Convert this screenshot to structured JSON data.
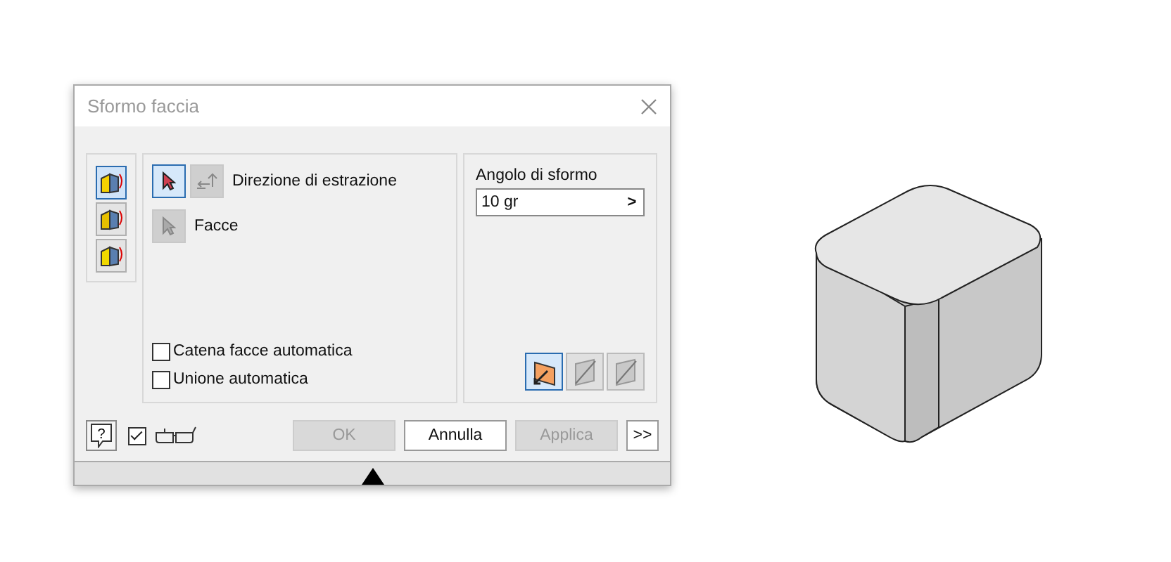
{
  "window": {
    "title": "Sformo faccia"
  },
  "draft_types": [
    {
      "selected": true
    },
    {
      "selected": false
    },
    {
      "selected": false
    }
  ],
  "selectors": [
    {
      "label": "Direzione di estrazione",
      "selected": true,
      "disabled": false,
      "flip": true
    },
    {
      "label": "Facce",
      "selected": false,
      "disabled": true,
      "flip": false
    }
  ],
  "options": [
    {
      "label": "Catena facce automatica",
      "checked": false
    },
    {
      "label": "Unione automatica",
      "checked": false
    }
  ],
  "angle": {
    "label": "Angolo di sformo",
    "value": "10 gr",
    "arrow": ">"
  },
  "direction_buttons": [
    {
      "selected": true,
      "disabled": false
    },
    {
      "selected": false,
      "disabled": true
    },
    {
      "selected": false,
      "disabled": true
    }
  ],
  "help": {
    "glyph": "?"
  },
  "preview": {
    "checked": true
  },
  "buttons": [
    {
      "label": "OK",
      "disabled": true
    },
    {
      "label": "Annulla",
      "disabled": false
    },
    {
      "label": "Applica",
      "disabled": true
    },
    {
      "label": ">>",
      "disabled": false
    }
  ]
}
